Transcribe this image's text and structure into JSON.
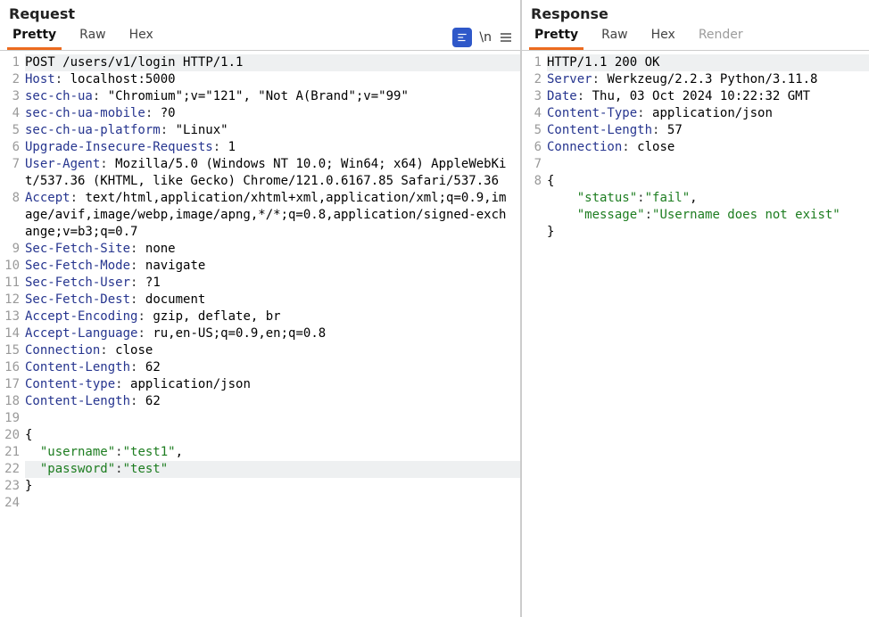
{
  "request": {
    "title": "Request",
    "tabs": [
      "Pretty",
      "Raw",
      "Hex"
    ],
    "active_tab": "Pretty",
    "tools": {
      "format_icon": "format-icon",
      "wrap_label": "\\n",
      "menu_icon": "hamburger"
    },
    "http": {
      "method": "POST",
      "path": "/users/v1/login",
      "version": "HTTP/1.1",
      "headers": [
        {
          "name": "Host",
          "value": "localhost:5000"
        },
        {
          "name": "sec-ch-ua",
          "value": "\"Chromium\";v=\"121\", \"Not A(Brand\";v=\"99\""
        },
        {
          "name": "sec-ch-ua-mobile",
          "value": "?0"
        },
        {
          "name": "sec-ch-ua-platform",
          "value": "\"Linux\""
        },
        {
          "name": "Upgrade-Insecure-Requests",
          "value": "1"
        },
        {
          "name": "User-Agent",
          "value": "Mozilla/5.0 (Windows NT 10.0; Win64; x64) AppleWebKit/537.36 (KHTML, like Gecko) Chrome/121.0.6167.85 Safari/537.36"
        },
        {
          "name": "Accept",
          "value": "text/html,application/xhtml+xml,application/xml;q=0.9,image/avif,image/webp,image/apng,*/*;q=0.8,application/signed-exchange;v=b3;q=0.7"
        },
        {
          "name": "Sec-Fetch-Site",
          "value": "none"
        },
        {
          "name": "Sec-Fetch-Mode",
          "value": "navigate"
        },
        {
          "name": "Sec-Fetch-User",
          "value": "?1"
        },
        {
          "name": "Sec-Fetch-Dest",
          "value": "document"
        },
        {
          "name": "Accept-Encoding",
          "value": "gzip, deflate, br"
        },
        {
          "name": "Accept-Language",
          "value": "ru,en-US;q=0.9,en;q=0.8"
        },
        {
          "name": "Connection",
          "value": "close"
        },
        {
          "name": "Content-Length",
          "value": "62"
        },
        {
          "name": "Content-type",
          "value": "application/json"
        },
        {
          "name": "Content-Length",
          "value": "62"
        }
      ],
      "body": {
        "username": "test1",
        "password": "test"
      },
      "highlight_body_key": "password"
    }
  },
  "response": {
    "title": "Response",
    "tabs": [
      "Pretty",
      "Raw",
      "Hex",
      "Render"
    ],
    "active_tab": "Pretty",
    "disabled_tabs": [
      "Render"
    ],
    "http": {
      "version": "HTTP/1.1",
      "status_code": "200",
      "status_text": "OK",
      "headers": [
        {
          "name": "Server",
          "value": "Werkzeug/2.2.3 Python/3.11.8"
        },
        {
          "name": "Date",
          "value": "Thu, 03 Oct 2024 10:22:32 GMT"
        },
        {
          "name": "Content-Type",
          "value": "application/json"
        },
        {
          "name": "Content-Length",
          "value": "57"
        },
        {
          "name": "Connection",
          "value": "close"
        }
      ],
      "body": {
        "status": "fail",
        "message": "Username does not exist"
      }
    }
  }
}
